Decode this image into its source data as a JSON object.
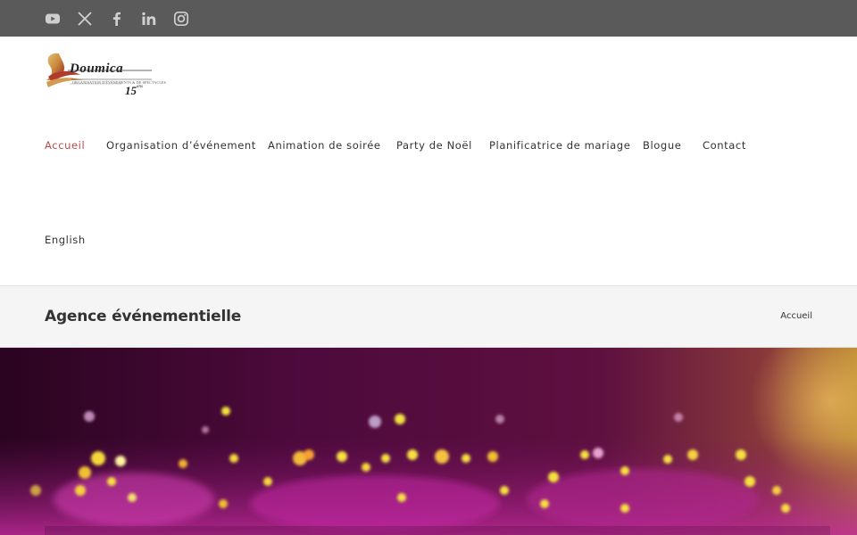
{
  "topbar": {
    "background": "#5a5a5a",
    "social_icons": [
      "youtube-icon",
      "x-twitter-icon",
      "facebook-icon",
      "linkedin-icon",
      "instagram-icon"
    ]
  },
  "logo": {
    "script": "Doumica",
    "tagline": "ORGANISATION D'ÉVÉNEMENTS & DE SPECTACLES",
    "years": "15",
    "years_suffix": "ans"
  },
  "nav": {
    "items": [
      {
        "label": "Accueil",
        "active": true
      },
      {
        "label": "Organisation d’événement"
      },
      {
        "label": "Animation de soirée"
      },
      {
        "label": "Party de Noël"
      },
      {
        "label": "Planificatrice de mariage"
      },
      {
        "label": "Blogue"
      },
      {
        "label": "Contact"
      }
    ],
    "language": "English",
    "active_color": "#c04a4a"
  },
  "page": {
    "title": "Agence événementielle",
    "breadcrumb": "Accueil"
  }
}
